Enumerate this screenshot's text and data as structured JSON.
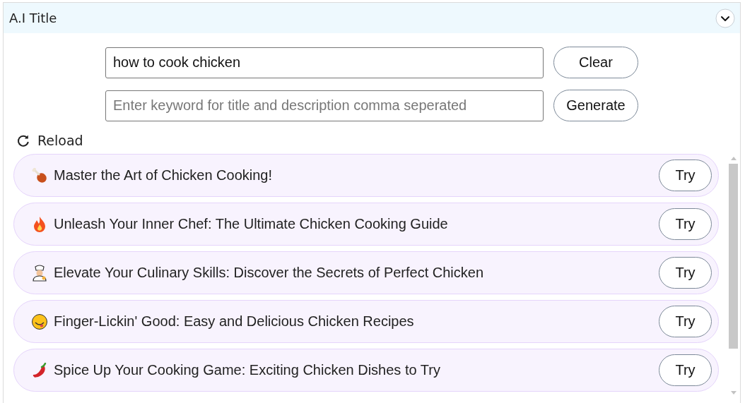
{
  "header": {
    "title": "A.I Title",
    "expanded": true
  },
  "topic_field": {
    "value": "how to cook chicken"
  },
  "keyword_field": {
    "placeholder": "Enter keyword for title and description comma seperated"
  },
  "buttons": [
    "Clear",
    "Generate"
  ],
  "reload": {
    "label": "Reload"
  },
  "suggestions": [
    {
      "kind": "drumstick",
      "text": "Master the Art of Chicken Cooking!",
      "action": "Try"
    },
    {
      "kind": "fire",
      "text": "Unleash Your Inner Chef: The Ultimate Chicken Cooking Guide",
      "action": "Try"
    },
    {
      "kind": "chef",
      "text": "Elevate Your Culinary Skills: Discover the Secrets of Perfect Chicken",
      "action": "Try"
    },
    {
      "kind": "smiley",
      "text": "Finger-Lickin' Good: Easy and Delicious Chicken Recipes",
      "action": "Try"
    },
    {
      "kind": "pepper",
      "text": "Spice Up Your Cooking Game: Exciting Chicken Dishes to Try",
      "action": "Try"
    }
  ]
}
